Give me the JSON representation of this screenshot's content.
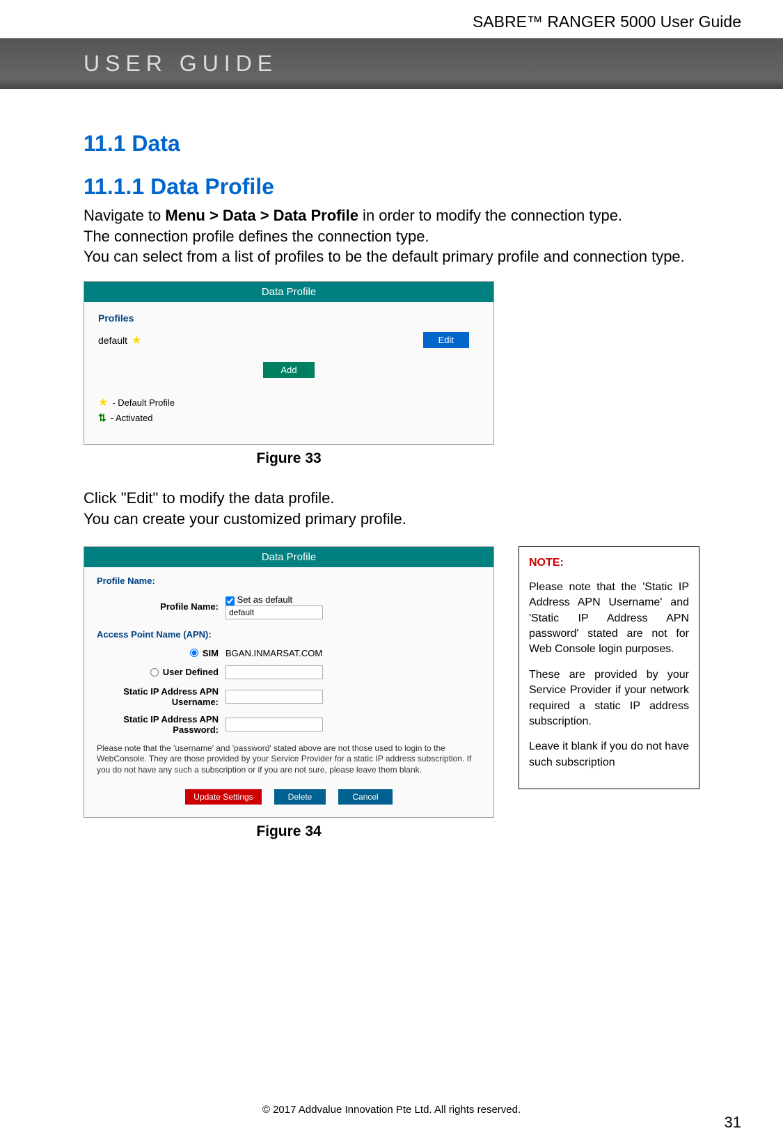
{
  "header": {
    "product": "SABRE™ RANGER 5000 User Guide"
  },
  "banner": {
    "text": "USER GUIDE"
  },
  "headings": {
    "h1": "11.1 Data",
    "h2": "11.1.1 Data Profile"
  },
  "intro": {
    "line1_pre": "Navigate to ",
    "line1_bold": "Menu > Data > Data Profile",
    "line1_post": " in order to modify the connection type.",
    "line2": "The connection profile defines the connection type.",
    "line3": "You can select from a list of profiles to be the default primary profile and connection type."
  },
  "screenshot1": {
    "title": "Data Profile",
    "profiles_label": "Profiles",
    "profile_name": "default",
    "edit_btn": "Edit",
    "add_btn": "Add",
    "legend_default": " - Default Profile",
    "legend_activated": " - Activated",
    "caption": "Figure 33"
  },
  "mid": {
    "line1": "Click \"Edit\" to modify the data profile.",
    "line2": "You can create your customized primary profile."
  },
  "screenshot2": {
    "title": "Data Profile",
    "section_profile": "Profile Name:",
    "label_profile_name": "Profile Name:",
    "set_default": "Set as default",
    "value_profile_name": "default",
    "section_apn": "Access Point Name (APN):",
    "label_sim": "SIM",
    "value_sim": "BGAN.INMARSAT.COM",
    "label_user_defined": "User Defined",
    "label_static_user": "Static IP Address APN Username:",
    "label_static_pass": "Static IP Address APN Password:",
    "note": "Please note that the 'username' and 'password' stated above are not those used to login to the WebConsole. They are those provided by your Service Provider for a static IP address subscription. If you do not have any such a subscription or if you are not sure, please leave them blank.",
    "btn_update": "Update Settings",
    "btn_delete": "Delete",
    "btn_cancel": "Cancel",
    "caption": "Figure 34"
  },
  "notebox": {
    "title": "NOTE:",
    "p1": "Please note that the 'Static IP Address APN Username' and 'Static IP Address APN password' stated are not for Web Console login purposes.",
    "p2": "These are provided by your Service Provider if your network required a static IP address subscription.",
    "p3": "Leave it blank if you do not have such subscription"
  },
  "footer": {
    "copyright": "© 2017 Addvalue Innovation Pte Ltd. All rights reserved.",
    "page": "31"
  }
}
